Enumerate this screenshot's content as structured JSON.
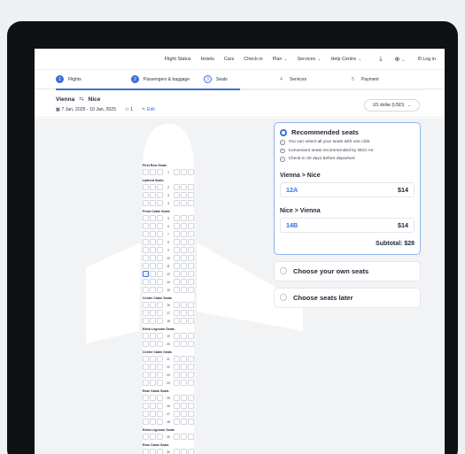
{
  "topnav": {
    "links": [
      "Flight Status",
      "Hotels",
      "Cars",
      "Check-in",
      "Plan",
      "Services",
      "Help Centre"
    ],
    "login": "Log in"
  },
  "steps": [
    "Flights",
    "Passengers & baggage",
    "Seats",
    "Services",
    "Payment"
  ],
  "step_numbers": [
    "1",
    "2",
    "3",
    "4",
    "5"
  ],
  "progress_fraction": 0.5,
  "trip": {
    "origin": "Vienna",
    "destination": "Nice",
    "dates": "7 Jan, 2025 - 10 Jan, 2025",
    "passengers": "1",
    "edit": "Edit",
    "currency": "US dollar (USD)"
  },
  "seatmap": {
    "sections": [
      {
        "name": "First Row Seats",
        "rows": [
          "1"
        ]
      },
      {
        "name": "Upfront Seats",
        "rows": [
          "2",
          "3",
          "4"
        ]
      },
      {
        "name": "Front Cabin Seats",
        "rows": [
          "5",
          "6",
          "7",
          "8",
          "9",
          "10",
          "11",
          "12",
          "14",
          "15"
        ]
      },
      {
        "name": "Centre Cabin Seats",
        "rows": [
          "16",
          "17",
          "18"
        ]
      },
      {
        "name": "Extra Legroom Seats",
        "rows": [
          "19",
          "20"
        ]
      },
      {
        "name": "Centre Cabin Seats",
        "rows": [
          "21",
          "22",
          "23",
          "24"
        ]
      },
      {
        "name": "Rear Cabin Seats",
        "rows": [
          "25",
          "26",
          "27",
          "28"
        ]
      },
      {
        "name": "Extra Legroom Seats",
        "rows": [
          "29"
        ]
      },
      {
        "name": "Rear Cabin Seats",
        "rows": [
          "30"
        ]
      }
    ],
    "selected_row": "12"
  },
  "recommended": {
    "title": "Recommended seats",
    "features": [
      "You can select all your seats with one click",
      "Convenient seats recommended by Wizz Air",
      "Check-in 30 days before departure"
    ],
    "legs": [
      {
        "route": "Vienna > Nice",
        "seat": "12A",
        "price": "$14"
      },
      {
        "route": "Nice > Vienna",
        "seat": "14B",
        "price": "$14"
      }
    ],
    "subtotal": "Subtotal: $28"
  },
  "options": [
    "Choose your own seats",
    "Choose seats later"
  ],
  "colors": {
    "accent": "#3b6fd8",
    "frame": "#101114",
    "background": "#f2f3f5"
  }
}
